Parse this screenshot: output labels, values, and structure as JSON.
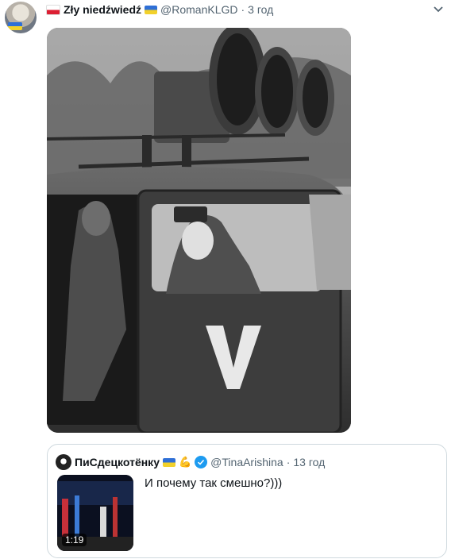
{
  "tweet": {
    "author_name": "Zły niedźwiedź",
    "handle": "@RomanKLGD",
    "separator": "·",
    "time": "3 год",
    "flag_left": "poland-flag",
    "flag_right": "ukraine-flag",
    "photo_overlay_letter": "V"
  },
  "quote": {
    "author_name": "ПиСдецкотёнку",
    "handle": "@TinaArishina",
    "separator": "·",
    "time": "13 год",
    "text": "И почему так смешно?)))",
    "video_duration": "1:19",
    "verified_icon": "verified-badge-icon"
  },
  "colors": {
    "text_primary": "#0f1419",
    "text_secondary": "#536471",
    "verified": "#1d9bf0",
    "border": "#cfd9de"
  }
}
